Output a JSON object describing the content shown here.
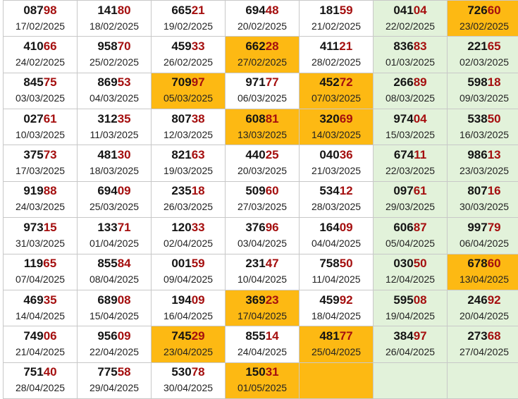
{
  "rows": [
    [
      {
        "head": "087",
        "tail": "98",
        "date": "17/02/2025",
        "hl": false
      },
      {
        "head": "141",
        "tail": "80",
        "date": "18/02/2025",
        "hl": false
      },
      {
        "head": "665",
        "tail": "21",
        "date": "19/02/2025",
        "hl": false
      },
      {
        "head": "694",
        "tail": "48",
        "date": "20/02/2025",
        "hl": false
      },
      {
        "head": "181",
        "tail": "59",
        "date": "21/02/2025",
        "hl": false
      },
      {
        "head": "041",
        "tail": "04",
        "date": "22/02/2025",
        "hl": false
      },
      {
        "head": "726",
        "tail": "60",
        "date": "23/02/2025",
        "hl": true
      }
    ],
    [
      {
        "head": "410",
        "tail": "66",
        "date": "24/02/2025",
        "hl": false
      },
      {
        "head": "958",
        "tail": "70",
        "date": "25/02/2025",
        "hl": false
      },
      {
        "head": "459",
        "tail": "33",
        "date": "26/02/2025",
        "hl": false
      },
      {
        "head": "662",
        "tail": "28",
        "date": "27/02/2025",
        "hl": true
      },
      {
        "head": "411",
        "tail": "21",
        "date": "28/02/2025",
        "hl": false
      },
      {
        "head": "836",
        "tail": "83",
        "date": "01/03/2025",
        "hl": false
      },
      {
        "head": "221",
        "tail": "65",
        "date": "02/03/2025",
        "hl": false
      }
    ],
    [
      {
        "head": "845",
        "tail": "75",
        "date": "03/03/2025",
        "hl": false
      },
      {
        "head": "869",
        "tail": "53",
        "date": "04/03/2025",
        "hl": false
      },
      {
        "head": "709",
        "tail": "97",
        "date": "05/03/2025",
        "hl": true
      },
      {
        "head": "971",
        "tail": "77",
        "date": "06/03/2025",
        "hl": false
      },
      {
        "head": "452",
        "tail": "72",
        "date": "07/03/2025",
        "hl": true
      },
      {
        "head": "266",
        "tail": "89",
        "date": "08/03/2025",
        "hl": false
      },
      {
        "head": "598",
        "tail": "18",
        "date": "09/03/2025",
        "hl": false
      }
    ],
    [
      {
        "head": "027",
        "tail": "61",
        "date": "10/03/2025",
        "hl": false
      },
      {
        "head": "312",
        "tail": "35",
        "date": "11/03/2025",
        "hl": false
      },
      {
        "head": "807",
        "tail": "38",
        "date": "12/03/2025",
        "hl": false
      },
      {
        "head": "608",
        "tail": "81",
        "date": "13/03/2025",
        "hl": true
      },
      {
        "head": "320",
        "tail": "69",
        "date": "14/03/2025",
        "hl": true
      },
      {
        "head": "974",
        "tail": "04",
        "date": "15/03/2025",
        "hl": false
      },
      {
        "head": "538",
        "tail": "50",
        "date": "16/03/2025",
        "hl": false
      }
    ],
    [
      {
        "head": "375",
        "tail": "73",
        "date": "17/03/2025",
        "hl": false
      },
      {
        "head": "481",
        "tail": "30",
        "date": "18/03/2025",
        "hl": false
      },
      {
        "head": "821",
        "tail": "63",
        "date": "19/03/2025",
        "hl": false
      },
      {
        "head": "440",
        "tail": "25",
        "date": "20/03/2025",
        "hl": false
      },
      {
        "head": "040",
        "tail": "36",
        "date": "21/03/2025",
        "hl": false
      },
      {
        "head": "674",
        "tail": "11",
        "date": "22/03/2025",
        "hl": false
      },
      {
        "head": "986",
        "tail": "13",
        "date": "23/03/2025",
        "hl": false
      }
    ],
    [
      {
        "head": "919",
        "tail": "88",
        "date": "24/03/2025",
        "hl": false
      },
      {
        "head": "694",
        "tail": "09",
        "date": "25/03/2025",
        "hl": false
      },
      {
        "head": "235",
        "tail": "18",
        "date": "26/03/2025",
        "hl": false
      },
      {
        "head": "509",
        "tail": "60",
        "date": "27/03/2025",
        "hl": false
      },
      {
        "head": "534",
        "tail": "12",
        "date": "28/03/2025",
        "hl": false
      },
      {
        "head": "097",
        "tail": "61",
        "date": "29/03/2025",
        "hl": false
      },
      {
        "head": "807",
        "tail": "16",
        "date": "30/03/2025",
        "hl": false
      }
    ],
    [
      {
        "head": "973",
        "tail": "15",
        "date": "31/03/2025",
        "hl": false
      },
      {
        "head": "133",
        "tail": "71",
        "date": "01/04/2025",
        "hl": false
      },
      {
        "head": "120",
        "tail": "33",
        "date": "02/04/2025",
        "hl": false
      },
      {
        "head": "376",
        "tail": "96",
        "date": "03/04/2025",
        "hl": false
      },
      {
        "head": "164",
        "tail": "09",
        "date": "04/04/2025",
        "hl": false
      },
      {
        "head": "606",
        "tail": "87",
        "date": "05/04/2025",
        "hl": false
      },
      {
        "head": "997",
        "tail": "79",
        "date": "06/04/2025",
        "hl": false
      }
    ],
    [
      {
        "head": "119",
        "tail": "65",
        "date": "07/04/2025",
        "hl": false
      },
      {
        "head": "855",
        "tail": "84",
        "date": "08/04/2025",
        "hl": false
      },
      {
        "head": "001",
        "tail": "59",
        "date": "09/04/2025",
        "hl": false
      },
      {
        "head": "231",
        "tail": "47",
        "date": "10/04/2025",
        "hl": false
      },
      {
        "head": "758",
        "tail": "50",
        "date": "11/04/2025",
        "hl": false
      },
      {
        "head": "030",
        "tail": "50",
        "date": "12/04/2025",
        "hl": false
      },
      {
        "head": "678",
        "tail": "60",
        "date": "13/04/2025",
        "hl": true
      }
    ],
    [
      {
        "head": "469",
        "tail": "35",
        "date": "14/04/2025",
        "hl": false
      },
      {
        "head": "689",
        "tail": "08",
        "date": "15/04/2025",
        "hl": false
      },
      {
        "head": "194",
        "tail": "09",
        "date": "16/04/2025",
        "hl": false
      },
      {
        "head": "369",
        "tail": "23",
        "date": "17/04/2025",
        "hl": true
      },
      {
        "head": "459",
        "tail": "92",
        "date": "18/04/2025",
        "hl": false
      },
      {
        "head": "595",
        "tail": "08",
        "date": "19/04/2025",
        "hl": false
      },
      {
        "head": "246",
        "tail": "92",
        "date": "20/04/2025",
        "hl": false
      }
    ],
    [
      {
        "head": "749",
        "tail": "06",
        "date": "21/04/2025",
        "hl": false
      },
      {
        "head": "956",
        "tail": "09",
        "date": "22/04/2025",
        "hl": false
      },
      {
        "head": "745",
        "tail": "29",
        "date": "23/04/2025",
        "hl": true
      },
      {
        "head": "855",
        "tail": "14",
        "date": "24/04/2025",
        "hl": false
      },
      {
        "head": "481",
        "tail": "77",
        "date": "25/04/2025",
        "hl": true
      },
      {
        "head": "384",
        "tail": "97",
        "date": "26/04/2025",
        "hl": false
      },
      {
        "head": "273",
        "tail": "68",
        "date": "27/04/2025",
        "hl": false
      }
    ],
    [
      {
        "head": "751",
        "tail": "40",
        "date": "28/04/2025",
        "hl": false
      },
      {
        "head": "775",
        "tail": "58",
        "date": "29/04/2025",
        "hl": false
      },
      {
        "head": "530",
        "tail": "78",
        "date": "30/04/2025",
        "hl": false
      },
      {
        "head": "150",
        "tail": "31",
        "date": "01/05/2025",
        "hl": true
      },
      {
        "head": "",
        "tail": "",
        "date": "",
        "hl": true
      },
      {
        "head": "",
        "tail": "",
        "date": "",
        "hl": false
      },
      {
        "head": "",
        "tail": "",
        "date": "",
        "hl": false
      }
    ]
  ],
  "colors": {
    "highlight": "#fdb913",
    "weekend": "#e2f2da",
    "tail_digits": "#a50f0f",
    "head_digits": "#141414"
  }
}
